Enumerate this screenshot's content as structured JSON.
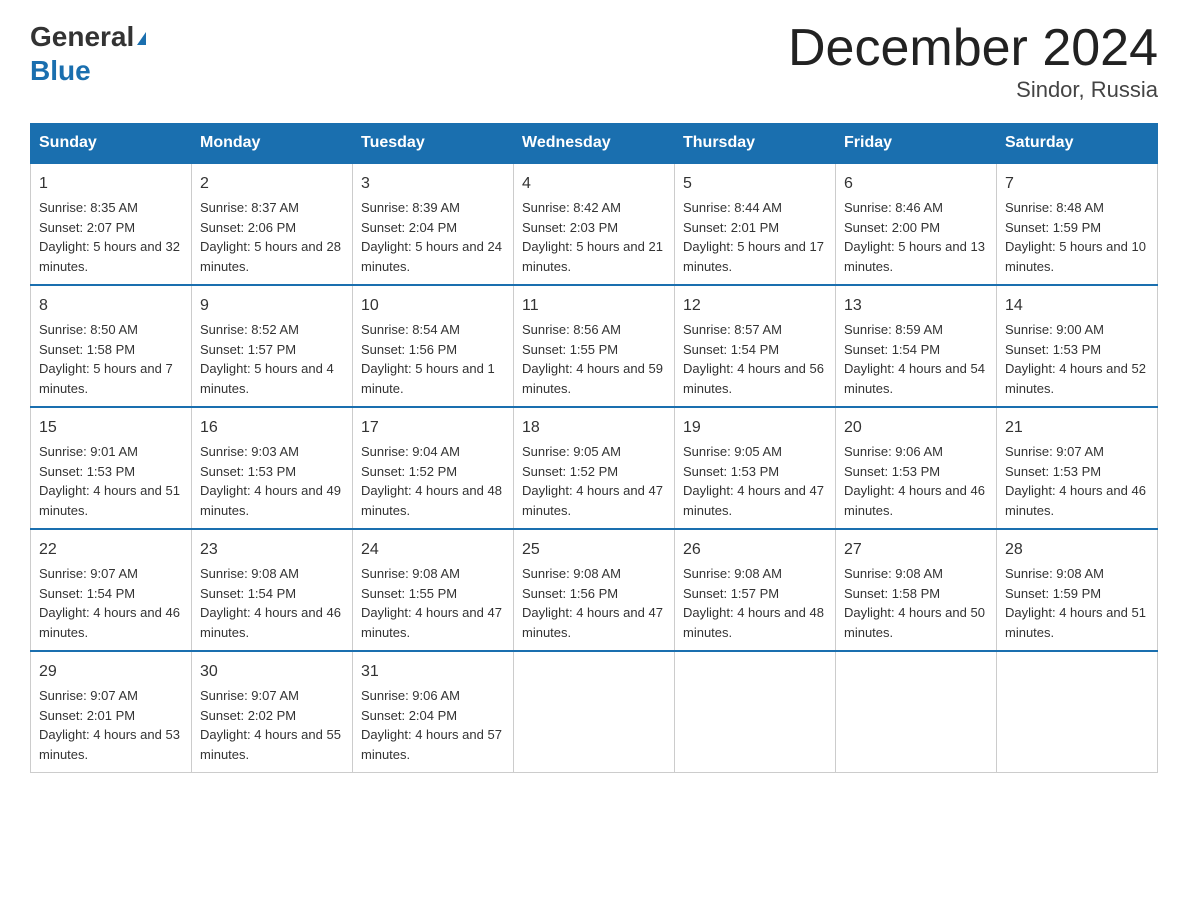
{
  "header": {
    "logo_line1": "General",
    "logo_line2": "Blue",
    "title": "December 2024",
    "subtitle": "Sindor, Russia"
  },
  "columns": [
    "Sunday",
    "Monday",
    "Tuesday",
    "Wednesday",
    "Thursday",
    "Friday",
    "Saturday"
  ],
  "weeks": [
    [
      {
        "day": "1",
        "sunrise": "8:35 AM",
        "sunset": "2:07 PM",
        "daylight": "5 hours and 32 minutes."
      },
      {
        "day": "2",
        "sunrise": "8:37 AM",
        "sunset": "2:06 PM",
        "daylight": "5 hours and 28 minutes."
      },
      {
        "day": "3",
        "sunrise": "8:39 AM",
        "sunset": "2:04 PM",
        "daylight": "5 hours and 24 minutes."
      },
      {
        "day": "4",
        "sunrise": "8:42 AM",
        "sunset": "2:03 PM",
        "daylight": "5 hours and 21 minutes."
      },
      {
        "day": "5",
        "sunrise": "8:44 AM",
        "sunset": "2:01 PM",
        "daylight": "5 hours and 17 minutes."
      },
      {
        "day": "6",
        "sunrise": "8:46 AM",
        "sunset": "2:00 PM",
        "daylight": "5 hours and 13 minutes."
      },
      {
        "day": "7",
        "sunrise": "8:48 AM",
        "sunset": "1:59 PM",
        "daylight": "5 hours and 10 minutes."
      }
    ],
    [
      {
        "day": "8",
        "sunrise": "8:50 AM",
        "sunset": "1:58 PM",
        "daylight": "5 hours and 7 minutes."
      },
      {
        "day": "9",
        "sunrise": "8:52 AM",
        "sunset": "1:57 PM",
        "daylight": "5 hours and 4 minutes."
      },
      {
        "day": "10",
        "sunrise": "8:54 AM",
        "sunset": "1:56 PM",
        "daylight": "5 hours and 1 minute."
      },
      {
        "day": "11",
        "sunrise": "8:56 AM",
        "sunset": "1:55 PM",
        "daylight": "4 hours and 59 minutes."
      },
      {
        "day": "12",
        "sunrise": "8:57 AM",
        "sunset": "1:54 PM",
        "daylight": "4 hours and 56 minutes."
      },
      {
        "day": "13",
        "sunrise": "8:59 AM",
        "sunset": "1:54 PM",
        "daylight": "4 hours and 54 minutes."
      },
      {
        "day": "14",
        "sunrise": "9:00 AM",
        "sunset": "1:53 PM",
        "daylight": "4 hours and 52 minutes."
      }
    ],
    [
      {
        "day": "15",
        "sunrise": "9:01 AM",
        "sunset": "1:53 PM",
        "daylight": "4 hours and 51 minutes."
      },
      {
        "day": "16",
        "sunrise": "9:03 AM",
        "sunset": "1:53 PM",
        "daylight": "4 hours and 49 minutes."
      },
      {
        "day": "17",
        "sunrise": "9:04 AM",
        "sunset": "1:52 PM",
        "daylight": "4 hours and 48 minutes."
      },
      {
        "day": "18",
        "sunrise": "9:05 AM",
        "sunset": "1:52 PM",
        "daylight": "4 hours and 47 minutes."
      },
      {
        "day": "19",
        "sunrise": "9:05 AM",
        "sunset": "1:53 PM",
        "daylight": "4 hours and 47 minutes."
      },
      {
        "day": "20",
        "sunrise": "9:06 AM",
        "sunset": "1:53 PM",
        "daylight": "4 hours and 46 minutes."
      },
      {
        "day": "21",
        "sunrise": "9:07 AM",
        "sunset": "1:53 PM",
        "daylight": "4 hours and 46 minutes."
      }
    ],
    [
      {
        "day": "22",
        "sunrise": "9:07 AM",
        "sunset": "1:54 PM",
        "daylight": "4 hours and 46 minutes."
      },
      {
        "day": "23",
        "sunrise": "9:08 AM",
        "sunset": "1:54 PM",
        "daylight": "4 hours and 46 minutes."
      },
      {
        "day": "24",
        "sunrise": "9:08 AM",
        "sunset": "1:55 PM",
        "daylight": "4 hours and 47 minutes."
      },
      {
        "day": "25",
        "sunrise": "9:08 AM",
        "sunset": "1:56 PM",
        "daylight": "4 hours and 47 minutes."
      },
      {
        "day": "26",
        "sunrise": "9:08 AM",
        "sunset": "1:57 PM",
        "daylight": "4 hours and 48 minutes."
      },
      {
        "day": "27",
        "sunrise": "9:08 AM",
        "sunset": "1:58 PM",
        "daylight": "4 hours and 50 minutes."
      },
      {
        "day": "28",
        "sunrise": "9:08 AM",
        "sunset": "1:59 PM",
        "daylight": "4 hours and 51 minutes."
      }
    ],
    [
      {
        "day": "29",
        "sunrise": "9:07 AM",
        "sunset": "2:01 PM",
        "daylight": "4 hours and 53 minutes."
      },
      {
        "day": "30",
        "sunrise": "9:07 AM",
        "sunset": "2:02 PM",
        "daylight": "4 hours and 55 minutes."
      },
      {
        "day": "31",
        "sunrise": "9:06 AM",
        "sunset": "2:04 PM",
        "daylight": "4 hours and 57 minutes."
      },
      null,
      null,
      null,
      null
    ]
  ],
  "labels": {
    "sunrise": "Sunrise:",
    "sunset": "Sunset:",
    "daylight": "Daylight:"
  }
}
